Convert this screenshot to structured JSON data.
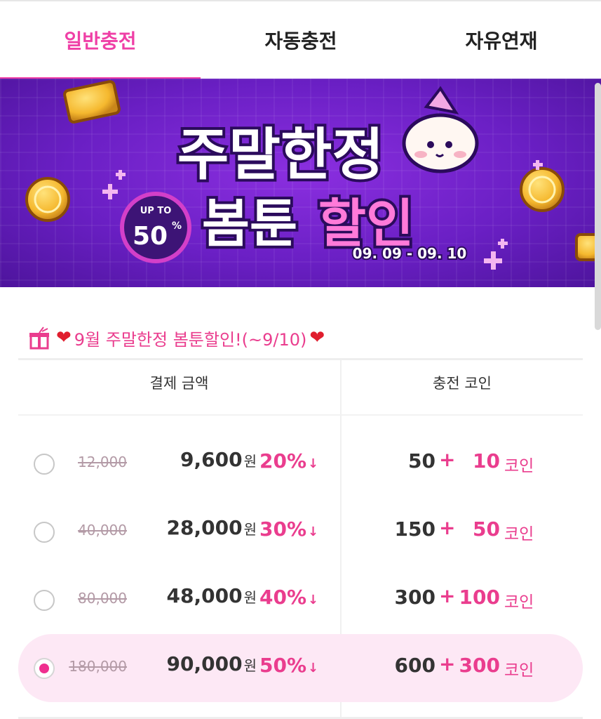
{
  "tabs": [
    {
      "label": "일반충전",
      "active": true
    },
    {
      "label": "자동충전",
      "active": false
    },
    {
      "label": "자유연재",
      "active": false
    }
  ],
  "banner": {
    "title_line1": "주말한정",
    "title_line2_a": "봄툰",
    "title_line2_b": "할인",
    "badge_top": "UP TO",
    "badge_value": "50",
    "badge_unit": "%",
    "dates": "09. 09 - 09. 10",
    "colors": {
      "background": "#6a1fc4",
      "title": "#ffffff",
      "accent": "#ff7ad9",
      "coin": "#f5b82e"
    }
  },
  "promo": {
    "gift_icon": "gift-icon",
    "heart_icon": "heart-icon",
    "text": "9월 주말한정 봄툰할인!(~9/10)"
  },
  "table": {
    "col_payment": "결제 금액",
    "col_coins": "충전 코인",
    "currency_suffix": "원",
    "coin_suffix": "코인",
    "plus": "+",
    "discount_arrow": "↓",
    "rows": [
      {
        "original": "12,000",
        "price": "9,600",
        "discount": "20%",
        "base": "50",
        "bonus": "10",
        "selected": false
      },
      {
        "original": "40,000",
        "price": "28,000",
        "discount": "30%",
        "base": "150",
        "bonus": "50",
        "selected": false
      },
      {
        "original": "80,000",
        "price": "48,000",
        "discount": "40%",
        "base": "300",
        "bonus": "100",
        "selected": false
      },
      {
        "original": "180,000",
        "price": "90,000",
        "discount": "50%",
        "base": "600",
        "bonus": "300",
        "selected": true
      }
    ]
  },
  "colors": {
    "accent": "#ef3fa6",
    "selected_row": "#fde8f5",
    "heart": "#e01e2e"
  }
}
